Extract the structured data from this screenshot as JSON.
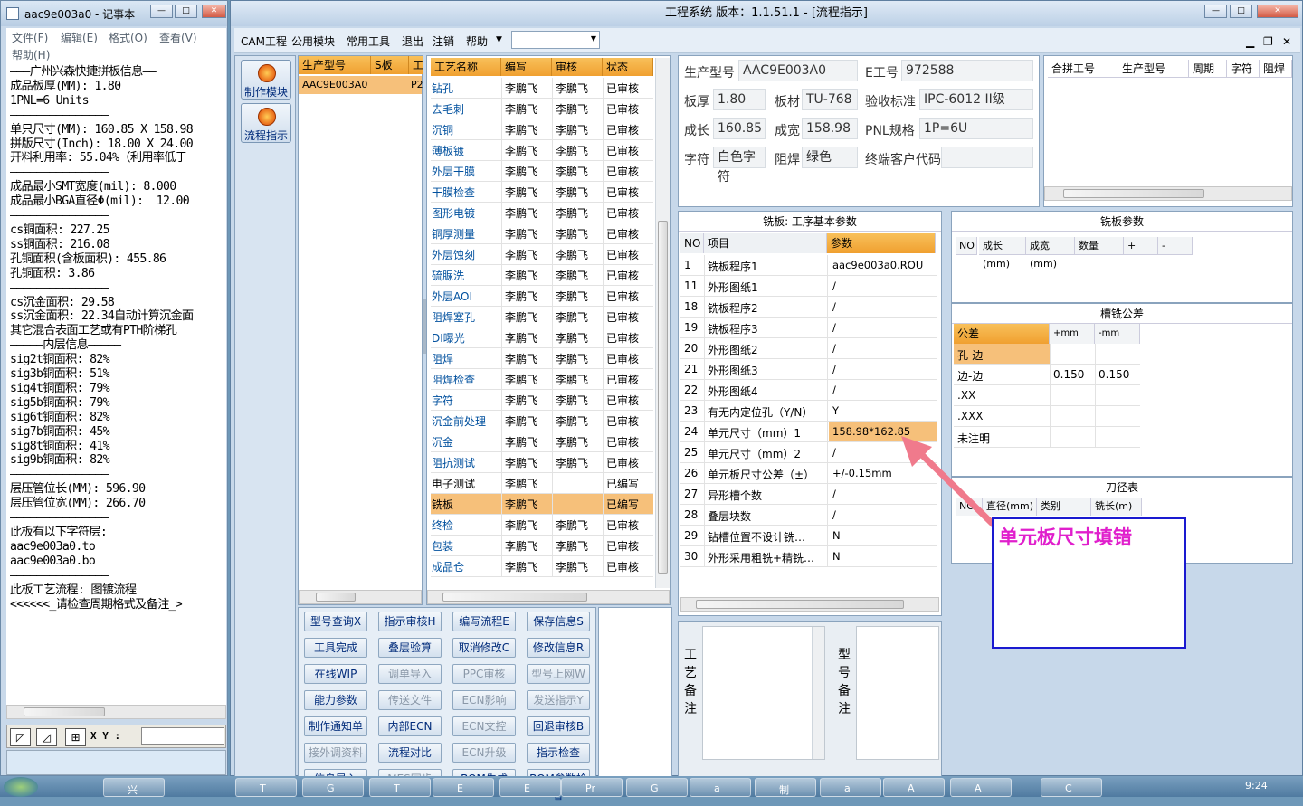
{
  "notepad": {
    "title": "aac9e003a0 - 记事本",
    "menu": [
      "文件(F)",
      "编辑(E)",
      "格式(O)",
      "查看(V)",
      "帮助(H)"
    ],
    "lines": [
      "———广州兴森快捷拼板信息——",
      "成品板厚(MM): 1.80",
      "1PNL=6 Units",
      "———————————————",
      "单只尺寸(MM): 160.85 X 158.98",
      "拼版尺寸(Inch): 18.00 X 24.00",
      "开料利用率: 55.04%（利用率低于",
      "———————————————",
      "成品最小SMT宽度(mil): 8.000",
      "成品最小BGA直径Φ(mil):  12.00",
      "———————————————",
      "cs铜面积: 227.25",
      "ss铜面积: 216.08",
      "孔铜面积(含板面积): 455.86",
      "孔铜面积: 3.86",
      "———————————————",
      "cs沉金面积: 29.58",
      "ss沉金面积: 22.34自动计算沉金面",
      "其它混合表面工艺或有PTH阶梯孔",
      "—————内层信息—————",
      "sig2t铜面积: 82%",
      "sig3b铜面积: 51%",
      "sig4t铜面积: 79%",
      "sig5b铜面积: 79%",
      "sig6t铜面积: 82%",
      "sig7b铜面积: 45%",
      "sig8t铜面积: 41%",
      "sig9b铜面积: 82%",
      "———————————————",
      "层压管位长(MM): 596.90",
      "层压管位宽(MM): 266.70",
      "———————————————",
      "此板有以下字符层:",
      "aac9e003a0.to",
      "aac9e003a0.bo",
      "———————————————",
      "此板工艺流程: 图镀流程",
      "<<<<<<_请检查周期格式及备注_>"
    ],
    "status": {
      "xy_label": "X Y :",
      "xy_value": ""
    }
  },
  "app": {
    "title": "工程系统  版本：1.1.51.1 - [流程指示]",
    "menu": [
      "CAM工程",
      "公用模块",
      "常用工具",
      "退出",
      "注销",
      "帮助"
    ],
    "sidebar": [
      "制作模块",
      "流程指示"
    ],
    "left_grid": {
      "headers": [
        "生产型号",
        "S板",
        "工"
      ],
      "rows": [
        {
          "model": "AAC9E003A0",
          "s": "P2"
        }
      ]
    },
    "process": {
      "headers": [
        "工艺名称",
        "编写",
        "审核",
        "状态"
      ],
      "rows": [
        {
          "name": "钻孔",
          "writer": "李鹏飞",
          "reviewer": "李鹏飞",
          "status": "已审核"
        },
        {
          "name": "去毛刺",
          "writer": "李鹏飞",
          "reviewer": "李鹏飞",
          "status": "已审核"
        },
        {
          "name": "沉铜",
          "writer": "李鹏飞",
          "reviewer": "李鹏飞",
          "status": "已审核"
        },
        {
          "name": "薄板镀",
          "writer": "李鹏飞",
          "reviewer": "李鹏飞",
          "status": "已审核"
        },
        {
          "name": "外层干膜",
          "writer": "李鹏飞",
          "reviewer": "李鹏飞",
          "status": "已审核"
        },
        {
          "name": "干膜检查",
          "writer": "李鹏飞",
          "reviewer": "李鹏飞",
          "status": "已审核"
        },
        {
          "name": "图形电镀",
          "writer": "李鹏飞",
          "reviewer": "李鹏飞",
          "status": "已审核"
        },
        {
          "name": "铜厚测量",
          "writer": "李鹏飞",
          "reviewer": "李鹏飞",
          "status": "已审核"
        },
        {
          "name": "外层蚀刻",
          "writer": "李鹏飞",
          "reviewer": "李鹏飞",
          "status": "已审核"
        },
        {
          "name": "硫脲洗",
          "writer": "李鹏飞",
          "reviewer": "李鹏飞",
          "status": "已审核"
        },
        {
          "name": "外层AOI",
          "writer": "李鹏飞",
          "reviewer": "李鹏飞",
          "status": "已审核"
        },
        {
          "name": "阻焊塞孔",
          "writer": "李鹏飞",
          "reviewer": "李鹏飞",
          "status": "已审核"
        },
        {
          "name": "DI曝光",
          "writer": "李鹏飞",
          "reviewer": "李鹏飞",
          "status": "已审核"
        },
        {
          "name": "阻焊",
          "writer": "李鹏飞",
          "reviewer": "李鹏飞",
          "status": "已审核"
        },
        {
          "name": "阻焊检查",
          "writer": "李鹏飞",
          "reviewer": "李鹏飞",
          "status": "已审核"
        },
        {
          "name": "字符",
          "writer": "李鹏飞",
          "reviewer": "李鹏飞",
          "status": "已审核"
        },
        {
          "name": "沉金前处理",
          "writer": "李鹏飞",
          "reviewer": "李鹏飞",
          "status": "已审核"
        },
        {
          "name": "沉金",
          "writer": "李鹏飞",
          "reviewer": "李鹏飞",
          "status": "已审核"
        },
        {
          "name": "阻抗测试",
          "writer": "李鹏飞",
          "reviewer": "李鹏飞",
          "status": "已审核"
        },
        {
          "name": "电子测试",
          "writer": "李鹏飞",
          "reviewer": "",
          "status": "已编写"
        },
        {
          "name": "铣板",
          "writer": "李鹏飞",
          "reviewer": "",
          "status": "已编写"
        },
        {
          "name": "终检",
          "writer": "李鹏飞",
          "reviewer": "李鹏飞",
          "status": "已审核"
        },
        {
          "name": "包装",
          "writer": "李鹏飞",
          "reviewer": "李鹏飞",
          "status": "已审核"
        },
        {
          "name": "成品仓",
          "writer": "李鹏飞",
          "reviewer": "李鹏飞",
          "status": "已审核"
        }
      ]
    },
    "buttons": [
      {
        "label": "型号查询X",
        "enabled": true
      },
      {
        "label": "指示审核H",
        "enabled": true
      },
      {
        "label": "编写流程E",
        "enabled": true
      },
      {
        "label": "保存信息S",
        "enabled": true
      },
      {
        "label": "工具完成",
        "enabled": true
      },
      {
        "label": "叠层验算",
        "enabled": true
      },
      {
        "label": "取消修改C",
        "enabled": true
      },
      {
        "label": "修改信息R",
        "enabled": true
      },
      {
        "label": "在线WIP",
        "enabled": true
      },
      {
        "label": "调单导入",
        "enabled": false
      },
      {
        "label": "PPC审核",
        "enabled": false
      },
      {
        "label": "型号上网W",
        "enabled": false
      },
      {
        "label": "能力参数",
        "enabled": true
      },
      {
        "label": "传送文件",
        "enabled": false
      },
      {
        "label": "ECN影响",
        "enabled": false
      },
      {
        "label": "发送指示Y",
        "enabled": false
      },
      {
        "label": "制作通知单",
        "enabled": true
      },
      {
        "label": "内部ECN",
        "enabled": true
      },
      {
        "label": "ECN文控",
        "enabled": false
      },
      {
        "label": "回退审核B",
        "enabled": true
      },
      {
        "label": "接外调资料",
        "enabled": false
      },
      {
        "label": "流程对比",
        "enabled": true
      },
      {
        "label": "ECN升级",
        "enabled": false
      },
      {
        "label": "指示检查",
        "enabled": true
      },
      {
        "label": "信息导入",
        "enabled": true
      },
      {
        "label": "MES同步",
        "enabled": false
      },
      {
        "label": "BOM生成",
        "enabled": true
      },
      {
        "label": "BOM参数检查",
        "enabled": true
      }
    ],
    "info": {
      "model_label": "生产型号",
      "model": "AAC9E003A0",
      "eng_label": "E工号",
      "eng": "972588",
      "thick_label": "板厚",
      "thick": "1.80",
      "material_label": "板材",
      "material": "TU-768",
      "std_label": "验收标准",
      "std": "IPC-6012 II级",
      "len_label": "成长",
      "len": "160.85",
      "width_label": "成宽",
      "width": "158.98",
      "pnl_label": "PNL规格",
      "pnl": "1P=6U",
      "char_label": "字符",
      "char": "白色字符",
      "mask_label": "阻焊",
      "mask": "绿色",
      "cust_label": "终端客户代码",
      "cust": ""
    },
    "combine_headers": [
      "合拼工号",
      "生产型号",
      "周期",
      "字符",
      "阻焊"
    ],
    "params": {
      "title": "铣板: 工序基本参数",
      "headers": [
        "NO",
        "项目",
        "参数"
      ],
      "rows": [
        {
          "no": "1",
          "item": "铣板程序1",
          "value": "aac9e003a0.ROU"
        },
        {
          "no": "11",
          "item": "外形图纸1",
          "value": "/"
        },
        {
          "no": "18",
          "item": "铣板程序2",
          "value": "/"
        },
        {
          "no": "19",
          "item": "铣板程序3",
          "value": "/"
        },
        {
          "no": "20",
          "item": "外形图纸2",
          "value": "/"
        },
        {
          "no": "21",
          "item": "外形图纸3",
          "value": "/"
        },
        {
          "no": "22",
          "item": "外形图纸4",
          "value": "/"
        },
        {
          "no": "23",
          "item": "有无内定位孔（Y/N）",
          "value": "Y"
        },
        {
          "no": "24",
          "item": "单元尺寸（mm）1",
          "value": "158.98*162.85"
        },
        {
          "no": "25",
          "item": "单元尺寸（mm）2",
          "value": "/"
        },
        {
          "no": "26",
          "item": "单元板尺寸公差（±）",
          "value": "+/-0.15mm"
        },
        {
          "no": "27",
          "item": "异形槽个数",
          "value": "/"
        },
        {
          "no": "28",
          "item": "叠层块数",
          "value": "/"
        },
        {
          "no": "29",
          "item": "钻槽位置不设计铣…",
          "value": "N"
        },
        {
          "no": "30",
          "item": "外形采用粗铣+精铣…",
          "value": "N"
        }
      ]
    },
    "mill": {
      "title": "铣板参数",
      "headers": [
        "NO",
        "成长(mm)",
        "成宽(mm)",
        "数量",
        "+",
        "-"
      ]
    },
    "slot": {
      "title": "槽铣公差",
      "headers": [
        "公差",
        "+mm",
        "-mm"
      ],
      "rows": [
        {
          "tol": "孔-边",
          "plus": "",
          "minus": ""
        },
        {
          "tol": "边-边",
          "plus": "0.150",
          "minus": "0.150"
        },
        {
          "tol": ".XX",
          "plus": "",
          "minus": ""
        },
        {
          "tol": ".XXX",
          "plus": "",
          "minus": ""
        },
        {
          "tol": "未注明",
          "plus": "",
          "minus": ""
        }
      ]
    },
    "tool": {
      "title": "刀径表",
      "headers": [
        "NO",
        "直径(mm)",
        "类别",
        "铣长(m)"
      ]
    },
    "remarks": {
      "process": "工艺备注",
      "model": "型号备注"
    },
    "annotation": "单元板尺寸填错"
  },
  "taskbar": {
    "clock": "9:24",
    "items": [
      "兴",
      "T",
      "G",
      "T",
      "E",
      "E",
      "Pr",
      "G",
      "a",
      "制",
      "a",
      "A",
      "A",
      "C"
    ]
  },
  "colors": {
    "header_orange": "#f0a030",
    "selected_row": "#fdd9a0",
    "annotation_border": "#1a1ad0",
    "annotation_text": "#e01fcc",
    "arrow": "#f07a8c"
  }
}
